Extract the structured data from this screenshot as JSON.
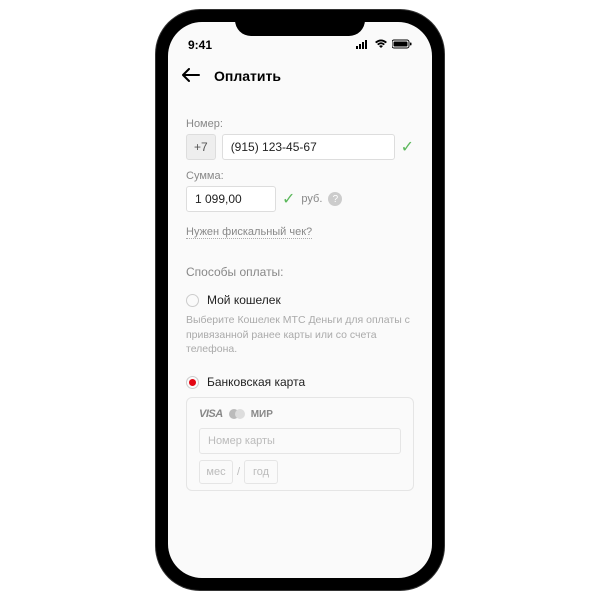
{
  "status": {
    "time": "9:41"
  },
  "header": {
    "title": "Оплатить"
  },
  "form": {
    "number_label": "Номер:",
    "prefix": "+7",
    "phone": "(915) 123-45-67",
    "sum_label": "Сумма:",
    "sum": "1 099,00",
    "currency": "руб.",
    "receipt_link": "Нужен фискальный чек?"
  },
  "payment": {
    "section_title": "Способы оплаты:",
    "wallet": {
      "label": "Мой кошелек",
      "hint": "Выберите Кошелек МТС Деньги для оплаты с привязанной ранее карты или со счета телефона."
    },
    "card": {
      "label": "Банковская карта",
      "visa": "VISA",
      "mir": "МИР",
      "number_placeholder": "Номер карты",
      "month_placeholder": "мес",
      "sep": "/",
      "year_placeholder": "год"
    }
  }
}
